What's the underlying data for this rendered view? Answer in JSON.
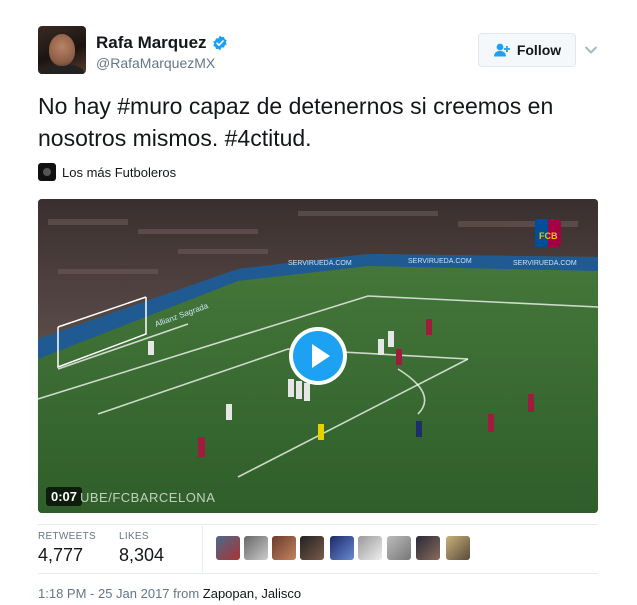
{
  "user": {
    "name": "Rafa Marquez",
    "handle": "@RafaMarquezMX"
  },
  "follow_label": "Follow",
  "tweet_text": "No hay #muro capaz de detenernos si creemos en nosotros mismos. #4ctitud.",
  "source": "Los más Futboleros",
  "video": {
    "duration": "0:07",
    "watermark": "UBE/FCBARCELONA",
    "ad_boards": [
      "SERVIRUEDA.COM",
      "SERVIRUEDA.COM",
      "SERVIRUEDA.COM",
      "Allianz",
      "Sagrada"
    ],
    "crest": "FCB"
  },
  "stats": {
    "retweets_label": "RETWEETS",
    "retweets": "4,777",
    "likes_label": "LIKES",
    "likes": "8,304"
  },
  "likers": [
    "liker-1",
    "liker-2",
    "liker-3",
    "liker-4",
    "liker-5",
    "liker-6",
    "liker-7",
    "liker-8",
    "liker-9"
  ],
  "colors": {
    "verified": "#1da1f2",
    "follow_icon": "#1da1f2",
    "play": "#1da1f2",
    "meta_text": "#657786"
  },
  "timestamp": "1:18 PM - 25 Jan 2017",
  "from_word": "from",
  "location": "Zapopan, Jalisco",
  "icons": {
    "verified": "verified-badge-icon",
    "follow": "add-user-icon",
    "more": "chevron-down-icon",
    "play": "play-icon"
  }
}
